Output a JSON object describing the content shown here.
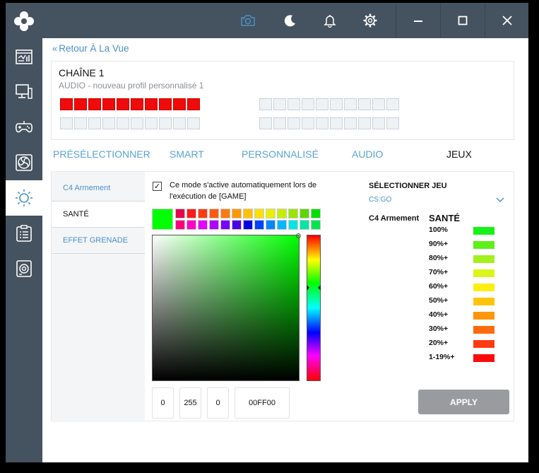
{
  "window": {
    "back_label": "Retour À La Vue"
  },
  "titlebar": {
    "icons": [
      "camera-icon",
      "moon-icon",
      "bell-icon",
      "gear-icon",
      "minimize-icon",
      "maximize-icon",
      "close-icon"
    ],
    "accent_color": "#4a90c8"
  },
  "sidebar": {
    "items": [
      {
        "icon": "dashboard-icon"
      },
      {
        "icon": "monitor-icon"
      },
      {
        "icon": "gamepad-icon"
      },
      {
        "icon": "fan-icon"
      },
      {
        "icon": "lighting-icon",
        "active": true
      },
      {
        "icon": "clipboard-icon"
      },
      {
        "icon": "speaker-icon"
      }
    ]
  },
  "profile": {
    "title": "CHAÎNE 1",
    "subtitle": "AUDIO - nouveau profil personnalisé 1",
    "led_color_on": "#f10a0a",
    "led_color_off": "#eef2f5"
  },
  "tabs": [
    {
      "label": "PRÉSÉLECTIONNER"
    },
    {
      "label": "SMART"
    },
    {
      "label": "PERSONNALISÉ"
    },
    {
      "label": "AUDIO"
    },
    {
      "label": "JEUX",
      "active": true
    }
  ],
  "modes": [
    {
      "label": "C4 Armement"
    },
    {
      "label": "SANTÉ",
      "active": true
    },
    {
      "label": "EFFET GRENADE"
    }
  ],
  "editor": {
    "checkbox_checked": true,
    "checkbox_label": "Ce mode s'active automatiquement lors de l'exécution de [GAME]",
    "current_color": "#00ff00",
    "swatch_colors": [
      "#e6004c",
      "#ff1a1a",
      "#ff3b14",
      "#ff5a10",
      "#ff7a0e",
      "#ff9800",
      "#ffc107",
      "#ffe000",
      "#e8f000",
      "#c6ef00",
      "#9ae600",
      "#5fd600",
      "#00e000",
      "#ff007f",
      "#ff00c8",
      "#e600ff",
      "#b000ff",
      "#7a00ff",
      "#4b00e6",
      "#0000e6",
      "#0044ff",
      "#0088ff",
      "#00b8ff",
      "#00e6e6",
      "#00e6a6",
      "#00e64c"
    ],
    "r": "0",
    "g": "255",
    "b": "0",
    "hex": "00FF00"
  },
  "game": {
    "select_title": "SÉLECTIONNER JEU",
    "selected": "CS:GO",
    "row_label": "C4 Armement",
    "health_title": "SANTÉ",
    "levels": [
      {
        "label": "100%",
        "color": "#17f117"
      },
      {
        "label": "90%+",
        "color": "#5ff01a"
      },
      {
        "label": "80%+",
        "color": "#a3f01e"
      },
      {
        "label": "70%+",
        "color": "#dcf51a"
      },
      {
        "label": "60%+",
        "color": "#ffef10"
      },
      {
        "label": "50%+",
        "color": "#ffc40a"
      },
      {
        "label": "40%+",
        "color": "#ff960a"
      },
      {
        "label": "30%+",
        "color": "#ff6a0c"
      },
      {
        "label": "20%+",
        "color": "#ff3a10"
      },
      {
        "label": "1-19%+",
        "color": "#ff0a0a"
      }
    ],
    "apply_label": "APPLY"
  }
}
